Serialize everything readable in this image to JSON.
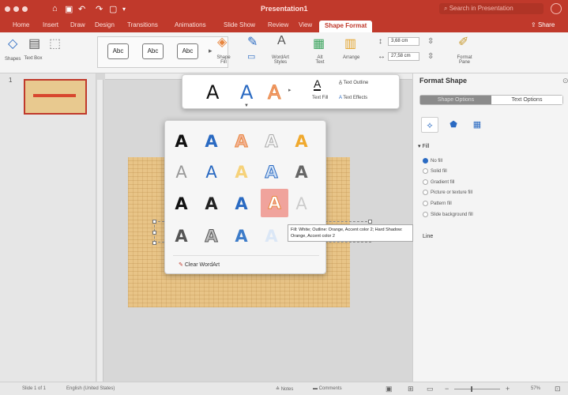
{
  "titlebar": {
    "doc_title": "Presentation1",
    "search_placeholder": "Search in Presentation"
  },
  "tabs": [
    "Home",
    "Insert",
    "Draw",
    "Design",
    "Transitions",
    "Animations",
    "Slide Show",
    "Review",
    "View",
    "Shape Format"
  ],
  "active_tab": "Shape Format",
  "share_label": "Share",
  "ribbon": {
    "shapes_label": "Shapes",
    "textbox_label": "Text Box",
    "style_samples": [
      "Abc",
      "Abc",
      "Abc"
    ],
    "shape_fill_label": "Shape Fill",
    "wordart_label": "WordArt Styles",
    "alt_text_label": "Alt Text",
    "arrange_label": "Arrange",
    "height_value": "3,68 cm",
    "width_value": "27,58 cm",
    "format_pane_label": "Format Pane"
  },
  "thumbs": {
    "slide_number": "1"
  },
  "text_style_popup": {
    "letters": [
      "A",
      "A",
      "A"
    ],
    "text_fill_label": "Text Fill",
    "text_outline_label": "Text Outline",
    "text_effects_label": "Text Effects"
  },
  "wordart": {
    "rows": [
      [
        "A",
        "A",
        "A",
        "A",
        "A"
      ],
      [
        "A",
        "A",
        "A",
        "A",
        "A"
      ],
      [
        "A",
        "A",
        "A",
        "A",
        "A"
      ],
      [
        "A",
        "A",
        "A",
        "A"
      ]
    ],
    "clear_label": "Clear WordArt",
    "tooltip": "Fill: White; Outline: Orange, Accent color 2; Hard Shadow: Orange, Accent color 2"
  },
  "panel": {
    "title": "Format Shape",
    "tab_shape_options": "Shape Options",
    "tab_text_options": "Text Options",
    "fill_section": "Fill",
    "fill_options": [
      "No fill",
      "Solid fill",
      "Gradient fill",
      "Picture or texture fill",
      "Pattern fill",
      "Slide background fill"
    ],
    "selected_fill": "No fill",
    "line_section": "Line"
  },
  "statusbar": {
    "slide_info": "Slide 1 of 1",
    "language": "English (United States)",
    "notes_label": "Notes",
    "comments_label": "Comments",
    "zoom": "57%"
  },
  "colors": {
    "accent": "#c0392b",
    "blue": "#2a6ac2",
    "orange": "#e8863f",
    "slide_texture": "#e8c487"
  }
}
